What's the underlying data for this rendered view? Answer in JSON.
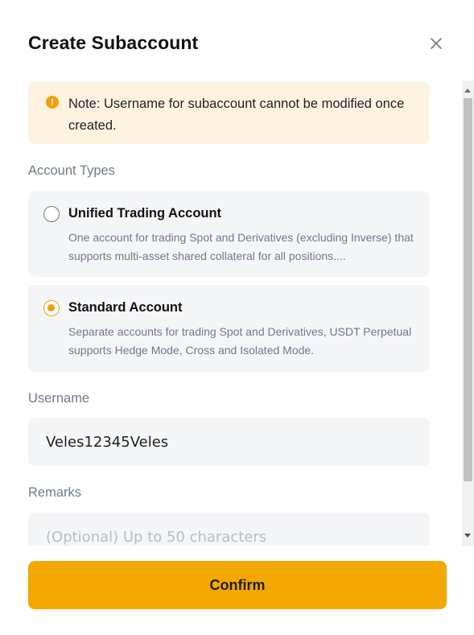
{
  "dialog": {
    "title": "Create Subaccount",
    "close_icon": "close-icon"
  },
  "notice": {
    "icon": "alert-circle-icon",
    "text": "Note: Username for subaccount cannot be modified once created."
  },
  "account_types": {
    "label": "Account Types",
    "options": [
      {
        "title": "Unified Trading Account",
        "description": "One account for trading Spot and Derivatives (excluding Inverse) that supports multi-asset shared collateral for all positions....",
        "selected": false
      },
      {
        "title": "Standard Account",
        "description": "Separate accounts for trading Spot and Derivatives, USDT Perpetual supports Hedge Mode, Cross and Isolated Mode.",
        "selected": true
      }
    ]
  },
  "username": {
    "label": "Username",
    "value": "Veles12345Veles"
  },
  "remarks": {
    "label": "Remarks",
    "placeholder": "(Optional) Up to 50 characters"
  },
  "confirm_label": "Confirm",
  "colors": {
    "accent": "#f4a700",
    "notice_bg": "#fef3df",
    "card_bg": "#f4f5f7"
  }
}
